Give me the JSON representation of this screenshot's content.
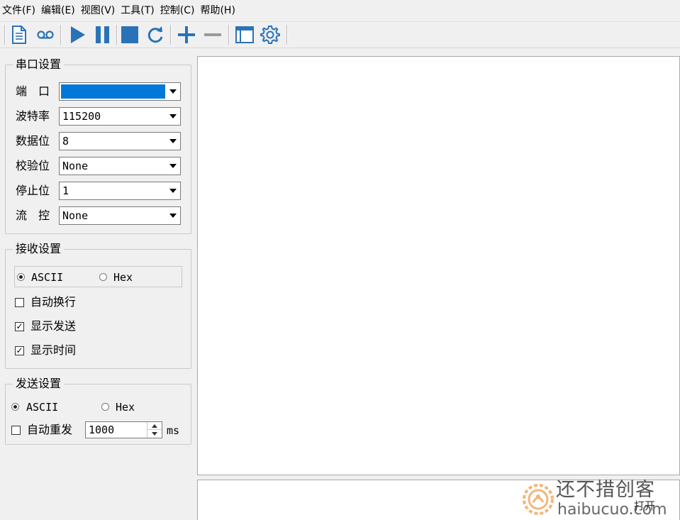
{
  "menu": {
    "items": [
      "文件(F)",
      "编辑(E)",
      "视图(V)",
      "工具(T)",
      "控制(C)",
      "帮助(H)"
    ]
  },
  "toolbar": {
    "icons": [
      "new-file-icon",
      "record-icon",
      "play-icon",
      "pause-icon",
      "stop-icon",
      "refresh-icon",
      "add-icon",
      "remove-icon",
      "window-icon",
      "settings-icon"
    ],
    "accent": "#2a72b8"
  },
  "serial": {
    "title": "串口设置",
    "port_label": "端　口",
    "port_value": "",
    "baud_label": "波特率",
    "baud_value": "115200",
    "databits_label": "数据位",
    "databits_value": "8",
    "parity_label": "校验位",
    "parity_value": "None",
    "stopbits_label": "停止位",
    "stopbits_value": "1",
    "flow_label": "流　控",
    "flow_value": "None",
    "selection_color": "#0078d7"
  },
  "receive": {
    "title": "接收设置",
    "mode_ascii": "ASCII",
    "mode_hex": "Hex",
    "selected_mode": "ASCII",
    "auto_wrap_label": "自动换行",
    "auto_wrap_checked": false,
    "show_send_label": "显示发送",
    "show_send_checked": true,
    "show_time_label": "显示时间",
    "show_time_checked": true
  },
  "send": {
    "title": "发送设置",
    "mode_ascii": "ASCII",
    "mode_hex": "Hex",
    "selected_mode": "ASCII",
    "auto_resend_label": "自动重发",
    "auto_resend_checked": false,
    "interval_value": "1000",
    "interval_unit": "ms"
  },
  "bottom": {
    "open_button_label": "打开"
  },
  "watermark": {
    "name": "还不措创客",
    "site": "haibucuo.com"
  }
}
